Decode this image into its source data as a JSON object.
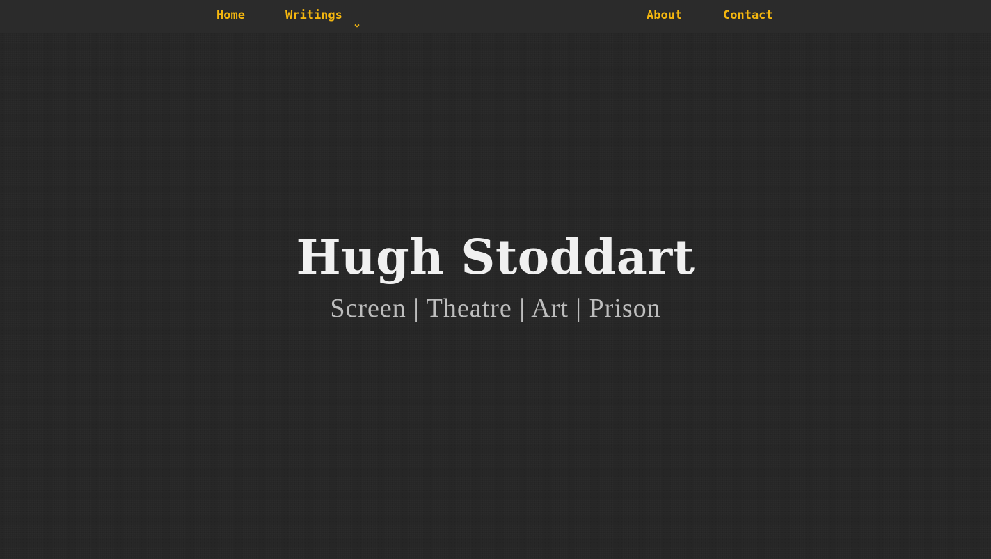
{
  "nav": {
    "home_label": "Home",
    "writings_label": "Writings",
    "writings_icon": "chevron-down-icon",
    "about_label": "About",
    "contact_label": "Contact",
    "link_color": "#f5b70f"
  },
  "hero": {
    "title": "Hugh Stoddart",
    "subtitle": "Screen | Theatre | Art | Prison"
  },
  "colors": {
    "background": "#262626",
    "navbar": "#2b2b2b",
    "title": "#f0f0f0",
    "subtitle": "#bdbdbd"
  }
}
